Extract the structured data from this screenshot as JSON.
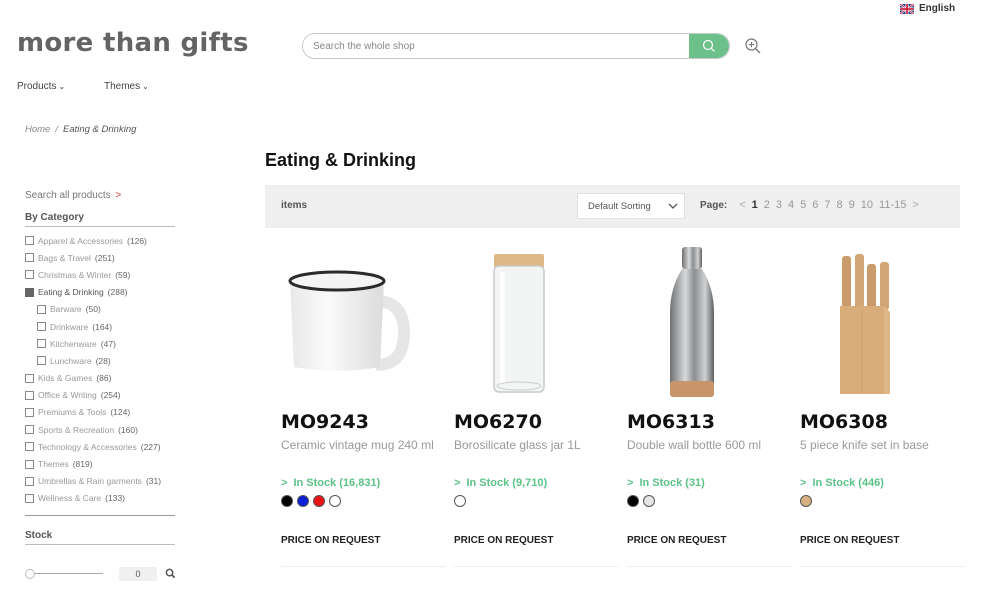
{
  "header": {
    "language": "English",
    "logo": "more than gifts",
    "search_placeholder": "Search the whole shop",
    "nav": [
      {
        "label": "Products"
      },
      {
        "label": "Themes"
      }
    ]
  },
  "breadcrumb": {
    "home": "Home",
    "separator": "/",
    "current": "Eating & Drinking"
  },
  "sidebar": {
    "search_all": "Search all products",
    "search_all_arrow": ">",
    "by_category_title": "By Category",
    "categories": [
      {
        "label": "Apparel & Accessories",
        "count": "(126)",
        "checked": false,
        "sub": false
      },
      {
        "label": "Bags & Travel",
        "count": "(251)",
        "checked": false,
        "sub": false
      },
      {
        "label": "Christmas & Winter",
        "count": "(59)",
        "checked": false,
        "sub": false
      },
      {
        "label": "Eating & Drinking",
        "count": "(288)",
        "checked": true,
        "sub": false
      },
      {
        "label": "Barware",
        "count": "(50)",
        "checked": false,
        "sub": true
      },
      {
        "label": "Drinkware",
        "count": "(164)",
        "checked": false,
        "sub": true
      },
      {
        "label": "Kitchenware",
        "count": "(47)",
        "checked": false,
        "sub": true
      },
      {
        "label": "Lunchware",
        "count": "(28)",
        "checked": false,
        "sub": true
      },
      {
        "label": "Kids & Games",
        "count": "(86)",
        "checked": false,
        "sub": false
      },
      {
        "label": "Office & Writing",
        "count": "(254)",
        "checked": false,
        "sub": false
      },
      {
        "label": "Premiums & Tools",
        "count": "(124)",
        "checked": false,
        "sub": false
      },
      {
        "label": "Sports & Recreation",
        "count": "(160)",
        "checked": false,
        "sub": false
      },
      {
        "label": "Technology & Accessories",
        "count": "(227)",
        "checked": false,
        "sub": false
      },
      {
        "label": "Themes",
        "count": "(819)",
        "checked": false,
        "sub": false
      },
      {
        "label": "Umbrellas & Rain garments",
        "count": "(31)",
        "checked": false,
        "sub": false
      },
      {
        "label": "Wellness & Care",
        "count": "(133)",
        "checked": false,
        "sub": false
      }
    ],
    "stock_title": "Stock",
    "stock_value": "0",
    "stock_slider_fraction": 0
  },
  "main": {
    "title": "Eating & Drinking",
    "items_label": "items",
    "sort_selected": "Default Sorting",
    "page_label": "Page:",
    "prev": "<",
    "next": ">",
    "pages": [
      "1",
      "2",
      "3",
      "4",
      "5",
      "6",
      "7",
      "8",
      "9",
      "10",
      "11-15"
    ],
    "current_page": "1"
  },
  "products": [
    {
      "code": "MO9243",
      "description": "Ceramic vintage mug 240 ml",
      "stock_prefix": ">",
      "stock": "In Stock (16,831)",
      "colors": [
        "#000000",
        "#0a1fd6",
        "#e81414",
        "#ffffff"
      ],
      "price": "PRICE ON REQUEST",
      "image": "mug"
    },
    {
      "code": "MO6270",
      "description": "Borosilicate glass jar 1L",
      "stock_prefix": ">",
      "stock": "In Stock (9,710)",
      "colors": [
        "#ffffff"
      ],
      "price": "PRICE ON REQUEST",
      "image": "glass-jar"
    },
    {
      "code": "MO6313",
      "description": "Double wall bottle 600 ml",
      "stock_prefix": ">",
      "stock": "In Stock (31)",
      "colors": [
        "#000000",
        "#e6e6e6"
      ],
      "price": "PRICE ON REQUEST",
      "image": "bottle"
    },
    {
      "code": "MO6308",
      "description": "5 piece knife set in base",
      "stock_prefix": ">",
      "stock": "In Stock (446)",
      "colors": [
        "#d8b07f"
      ],
      "price": "PRICE ON REQUEST",
      "image": "knife-set"
    }
  ],
  "colors": {
    "accent_green": "#6cc18b",
    "stock_green": "#5cc287",
    "logo_gray": "#636466"
  }
}
